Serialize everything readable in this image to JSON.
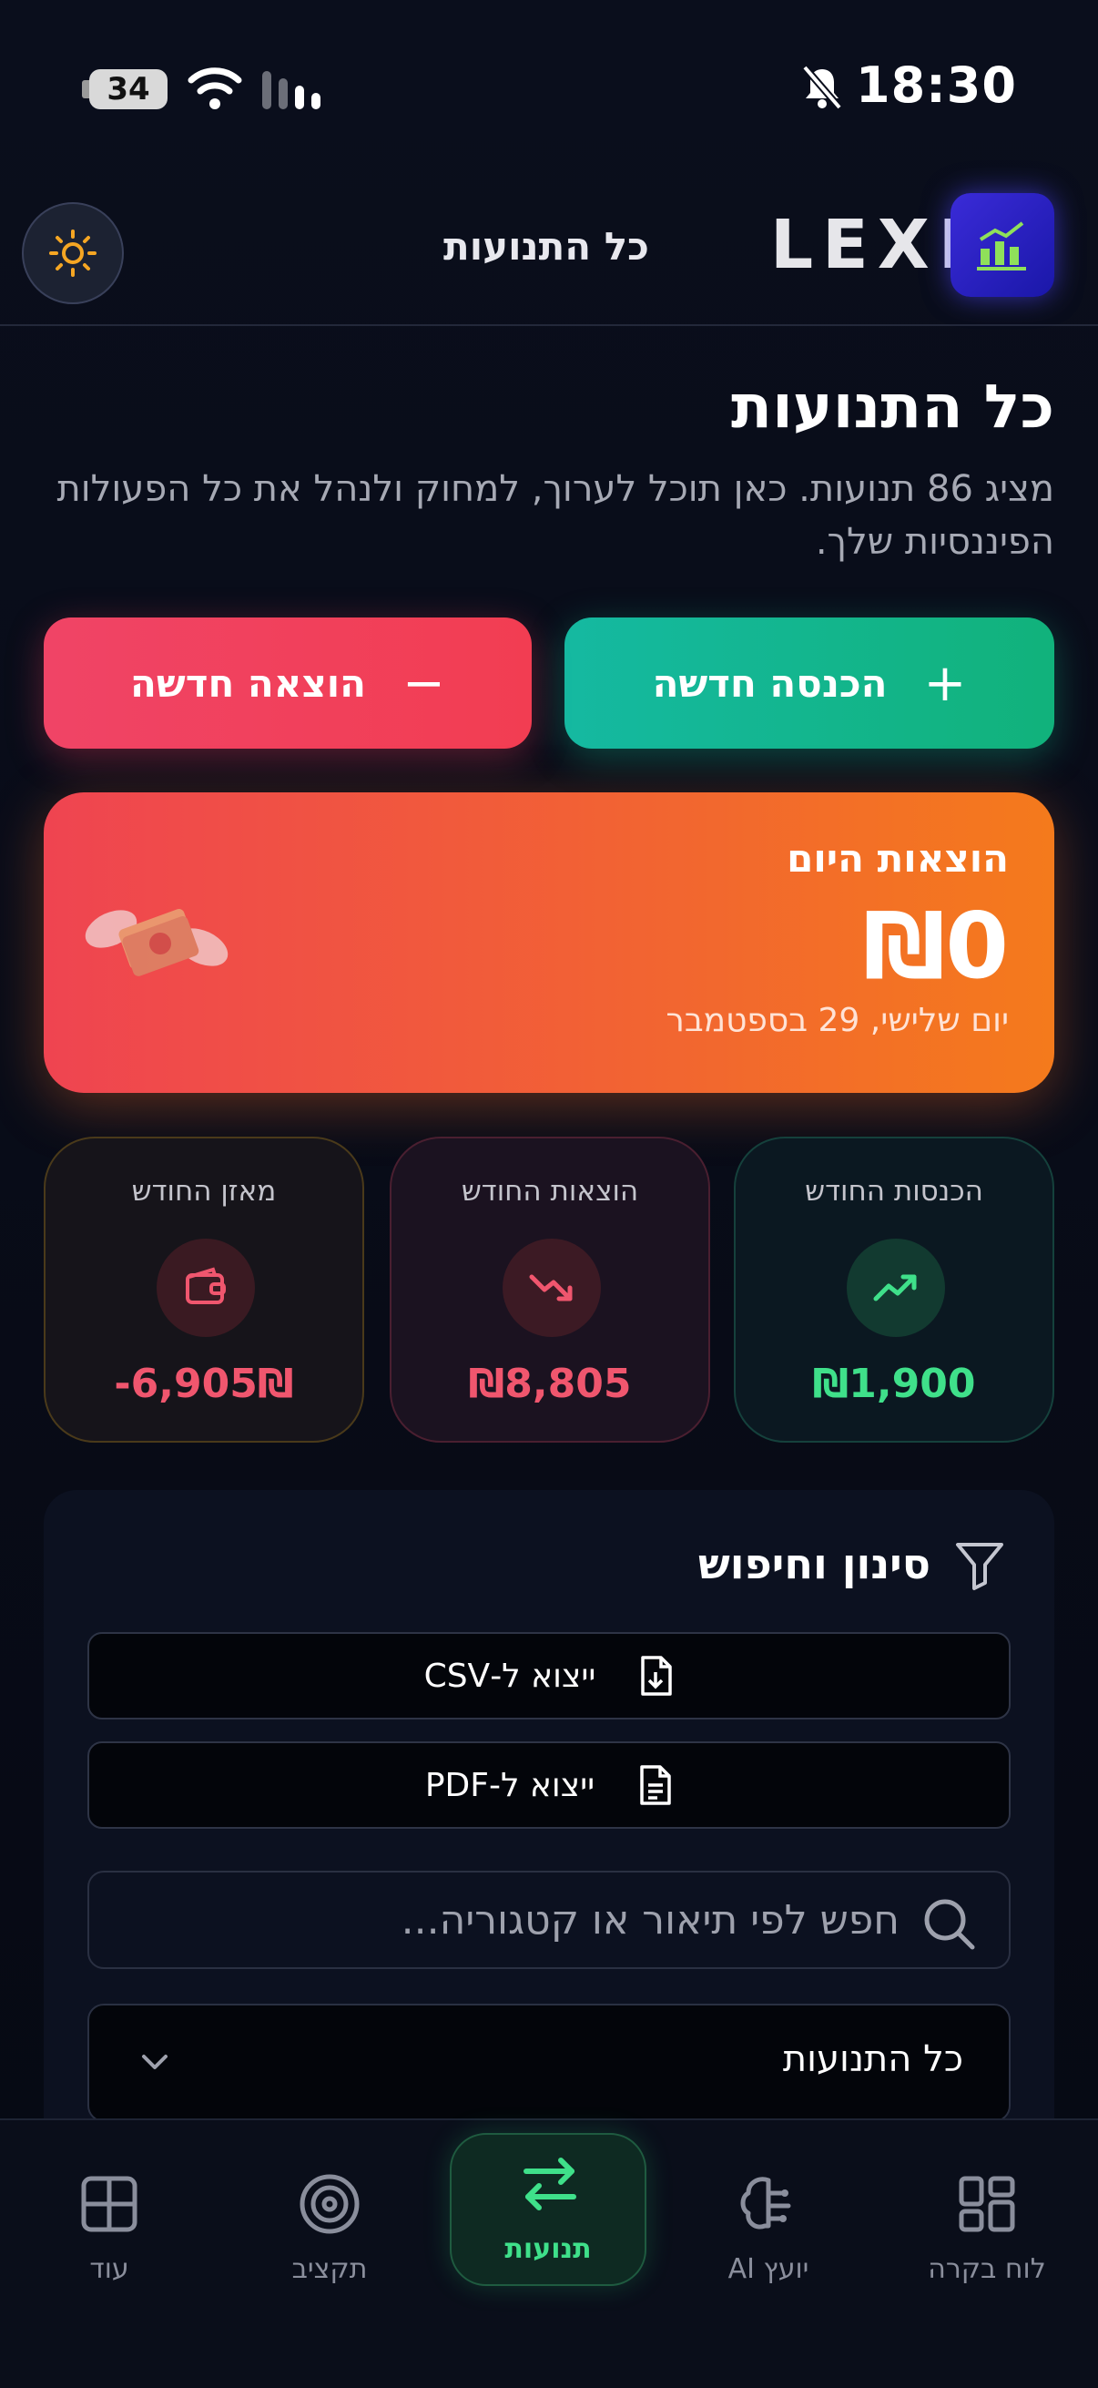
{
  "status_bar": {
    "battery": "34",
    "time": "18:30"
  },
  "header": {
    "title": "כל התנועות",
    "logo": "LEXI"
  },
  "main": {
    "heading": "כל התנועות",
    "subtitle": "מציג 86 תנועות. כאן תוכל לערוך, למחוק ולנהל את כל הפעולות הפיננסיות שלך."
  },
  "actions": {
    "new_income": "הכנסה חדשה",
    "new_expense": "הוצאה חדשה",
    "income_symbol": "+",
    "expense_symbol": "−"
  },
  "today": {
    "label": "הוצאות היום",
    "amount": "₪0",
    "date": "יום שלישי, 29 בספטמבר"
  },
  "stats": {
    "income": {
      "label": "הכנסות החודש",
      "value": "₪1,900",
      "color": "#3fe08a"
    },
    "expense": {
      "label": "הוצאות החודש",
      "value": "₪8,805",
      "color": "#f0566e"
    },
    "balance": {
      "label": "מאזן החודש",
      "value": "-6,905₪",
      "color": "#f0566e"
    }
  },
  "filter": {
    "title": "סינון וחיפוש",
    "export_csv": "ייצוא ל-CSV",
    "export_pdf": "ייצוא ל-PDF",
    "search_placeholder": "חפש לפי תיאור או קטגוריה...",
    "select_value": "כל התנועות"
  },
  "nav": {
    "dashboard": "לוח בקרה",
    "ai_advisor": "יועץ AI",
    "transactions": "תנועות",
    "budget": "תקציב",
    "more": "עוד"
  },
  "colors": {
    "income_green": "#11b27b",
    "expense_red": "#f23d52",
    "today_orange": "#f47a1c",
    "active_nav": "#3fe08a"
  }
}
